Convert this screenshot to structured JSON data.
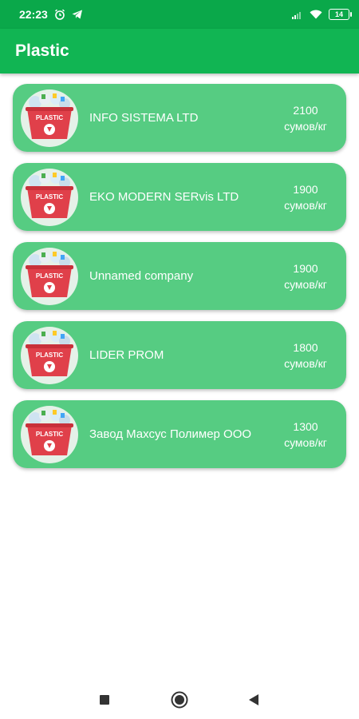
{
  "status_bar": {
    "time": "22:23",
    "battery": "14"
  },
  "app_bar": {
    "title": "Plastic"
  },
  "logo_text": "PLASTIC",
  "companies": [
    {
      "name": "INFO SISTEMA LTD",
      "price": "2100",
      "unit": "сумов/кг"
    },
    {
      "name": "EKO MODERN SERvis LTD",
      "price": "1900",
      "unit": "сумов/кг"
    },
    {
      "name": "Unnamed company",
      "price": "1900",
      "unit": "сумов/кг"
    },
    {
      "name": "LIDER PROM",
      "price": "1800",
      "unit": "сумов/кг"
    },
    {
      "name": "Завод Махсус Полимер ООО",
      "price": "1300",
      "unit": "сумов/кг"
    }
  ],
  "colors": {
    "status_bar": "#0aa84a",
    "app_bar": "#11b553",
    "card": "#56cc82",
    "bucket": "#e0404a"
  },
  "icons": {
    "status_left": [
      "alarm-icon",
      "telegram-icon"
    ],
    "status_right": [
      "signal-icon",
      "wifi-icon",
      "battery-icon"
    ],
    "nav": [
      "recents-square-icon",
      "home-circle-icon",
      "back-triangle-icon"
    ]
  }
}
